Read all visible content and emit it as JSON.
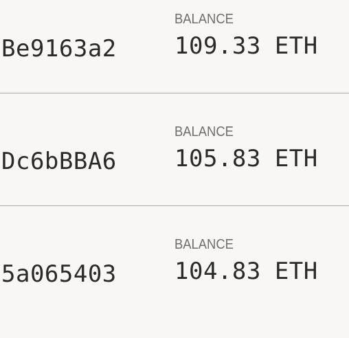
{
  "accounts": [
    {
      "address": "Be9163a2",
      "balance_label": "BALANCE",
      "balance": "109.33",
      "unit": "ETH"
    },
    {
      "address": "Dc6bBBA6",
      "balance_label": "BALANCE",
      "balance": "105.83",
      "unit": "ETH"
    },
    {
      "address": "5a065403",
      "balance_label": "BALANCE",
      "balance": "104.83",
      "unit": "ETH"
    }
  ],
  "colors": {
    "background": "#f8f7f5",
    "text": "#2a2a2a",
    "label": "#6e6e6e",
    "divider": "#a9a9a9"
  }
}
